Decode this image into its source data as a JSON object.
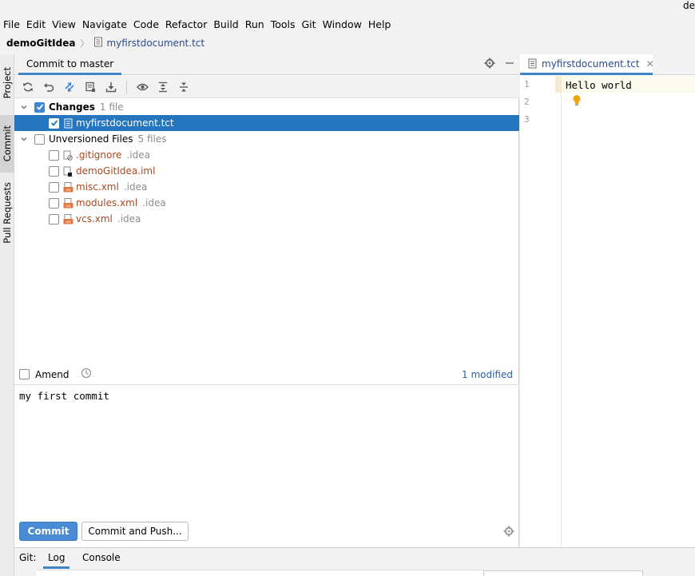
{
  "window": {
    "title_fragment": "de"
  },
  "menu": [
    "File",
    "Edit",
    "View",
    "Navigate",
    "Code",
    "Refactor",
    "Build",
    "Run",
    "Tools",
    "Git",
    "Window",
    "Help"
  ],
  "breadcrumb": {
    "project": "demoGitIdea",
    "file": "myfirstdocument.tct"
  },
  "left_strip": {
    "project": "Project",
    "commit": "Commit",
    "pull_requests": "Pull Requests"
  },
  "commit_panel": {
    "title": "Commit to master",
    "toolbar_icons": [
      "refresh-icon",
      "rollback-icon",
      "diff-icon",
      "shelve-icon",
      "download-icon",
      "eye-icon",
      "expand-all-icon",
      "collapse-all-icon"
    ],
    "changes": {
      "label": "Changes",
      "count": "1 file",
      "files": [
        {
          "name": "myfirstdocument.tct"
        }
      ]
    },
    "unversioned": {
      "label": "Unversioned Files",
      "count": "5 files",
      "files": [
        {
          "name": ".gitignore",
          "dir": ".idea"
        },
        {
          "name": "demoGitIdea.iml",
          "dir": ""
        },
        {
          "name": "misc.xml",
          "dir": ".idea"
        },
        {
          "name": "modules.xml",
          "dir": ".idea"
        },
        {
          "name": "vcs.xml",
          "dir": ".idea"
        }
      ]
    },
    "amend_label": "Amend",
    "modified": "1 modified",
    "message": "my first commit",
    "commit_button": "Commit",
    "commit_push_button": "Commit and Push..."
  },
  "editor": {
    "tab": "myfirstdocument.tct",
    "lines": [
      "1",
      "2",
      "3"
    ],
    "content": "Hello world"
  },
  "bottom": {
    "git_label": "Git:",
    "log_tab": "Log",
    "console_tab": "Console"
  },
  "colors": {
    "accent": "#2675bf",
    "primary_button": "#4a8bd4",
    "unversioned_text": "#a6491e",
    "link_blue": "#2a5fa8"
  }
}
